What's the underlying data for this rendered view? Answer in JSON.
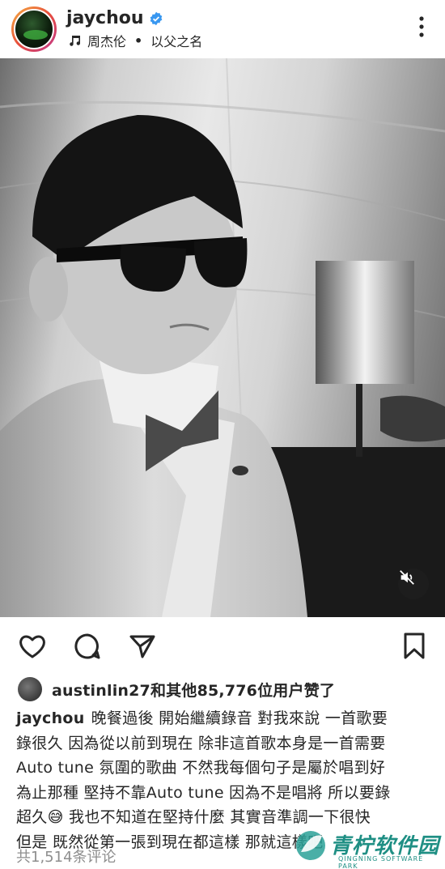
{
  "header": {
    "username": "jaychou",
    "music_artist": "周杰伦",
    "separator": "•",
    "song_title": "以父之名"
  },
  "post": {
    "likes_text": "austinlin27和其他85,776位用户赞了",
    "caption_user": "jaychou",
    "caption_lines": [
      "晚餐過後 開始繼續錄音 對我來說 一首歌要",
      "錄很久 因為從以前到現在 除非這首歌本身是一首需要",
      "Auto tune 氛圍的歌曲 不然我每個句子是屬於唱到好",
      "為止那種 堅持不靠Auto tune 因為不是唱將 所以要錄",
      "超久😅 我也不知道在堅持什麼 其實音準調一下很快",
      "但是 既然從第一張到現在都這樣 那就這樣吧"
    ],
    "comments_text": "共1,514条评论"
  },
  "watermark": {
    "brand": "青柠软件园",
    "sub": "QINGNING SOFTWARE PARK"
  },
  "colors": {
    "text": "#262626",
    "muted": "#8e8e8e",
    "verified": "#3897f0",
    "watermark": "#1f8f84"
  }
}
